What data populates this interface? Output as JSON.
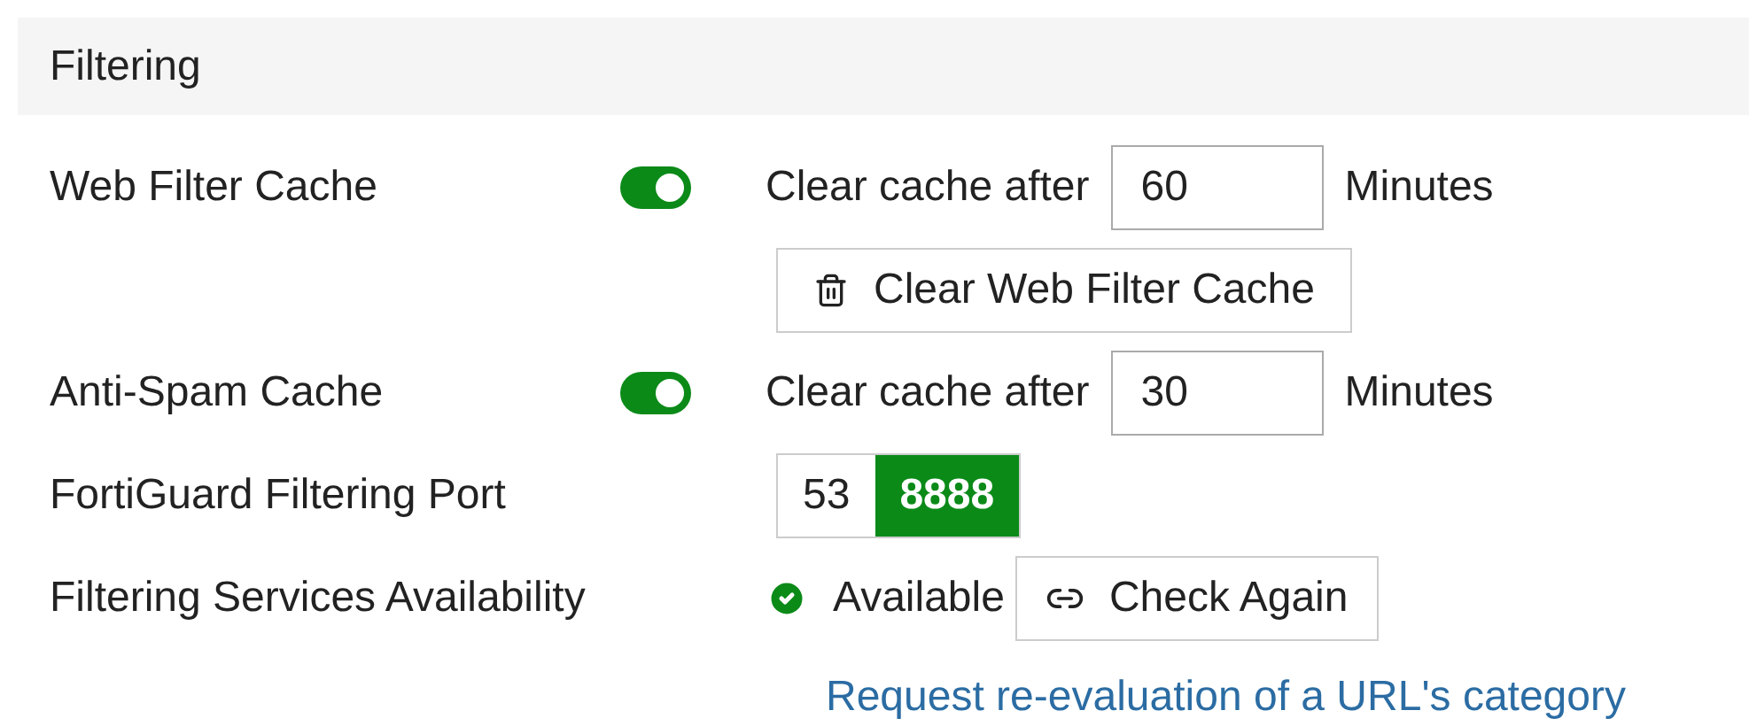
{
  "section": {
    "title": "Filtering"
  },
  "rows": [
    {
      "kind": "cache",
      "label": "Web Filter Cache",
      "on": true,
      "prefix": "Clear cache after",
      "value": "60",
      "unit": "Minutes"
    },
    {
      "kind": "button",
      "button": "Clear Web Filter Cache"
    },
    {
      "kind": "cache",
      "label": "Anti-Spam Cache",
      "on": true,
      "prefix": "Clear cache after",
      "value": "30",
      "unit": "Minutes"
    },
    {
      "kind": "port",
      "label": "FortiGuard Filtering Port",
      "options": [
        {
          "label": "53",
          "selected": false
        },
        {
          "label": "8888",
          "selected": true
        }
      ]
    },
    {
      "kind": "status",
      "label": "Filtering Services Availability",
      "status": "Available",
      "button": "Check Again"
    },
    {
      "kind": "link",
      "link": "Request re-evaluation of a URL's category"
    }
  ]
}
